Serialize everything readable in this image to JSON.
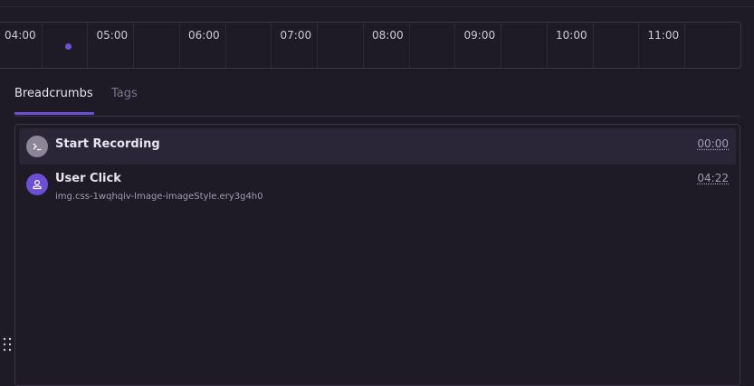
{
  "timeline": {
    "ticks": [
      "04:00",
      "05:00",
      "06:00",
      "07:00",
      "08:00",
      "09:00",
      "10:00",
      "11:00"
    ],
    "events": [
      {
        "time": "04:22",
        "type": "user-click"
      }
    ]
  },
  "tabs": [
    {
      "label": "Breadcrumbs",
      "active": true
    },
    {
      "label": "Tags",
      "active": false
    }
  ],
  "breadcrumbs": [
    {
      "icon": "terminal-icon",
      "title": "Start Recording",
      "description": "",
      "time": "00:00"
    },
    {
      "icon": "user-icon",
      "title": "User Click",
      "description": "img.css-1wqhqiv-Image-imageStyle.ery3g4h0",
      "time": "04:22"
    }
  ],
  "colors": {
    "background": "#1e1a26",
    "accent": "#6d4fd6",
    "border": "#3a3446",
    "row_highlight": "#2b2538"
  }
}
